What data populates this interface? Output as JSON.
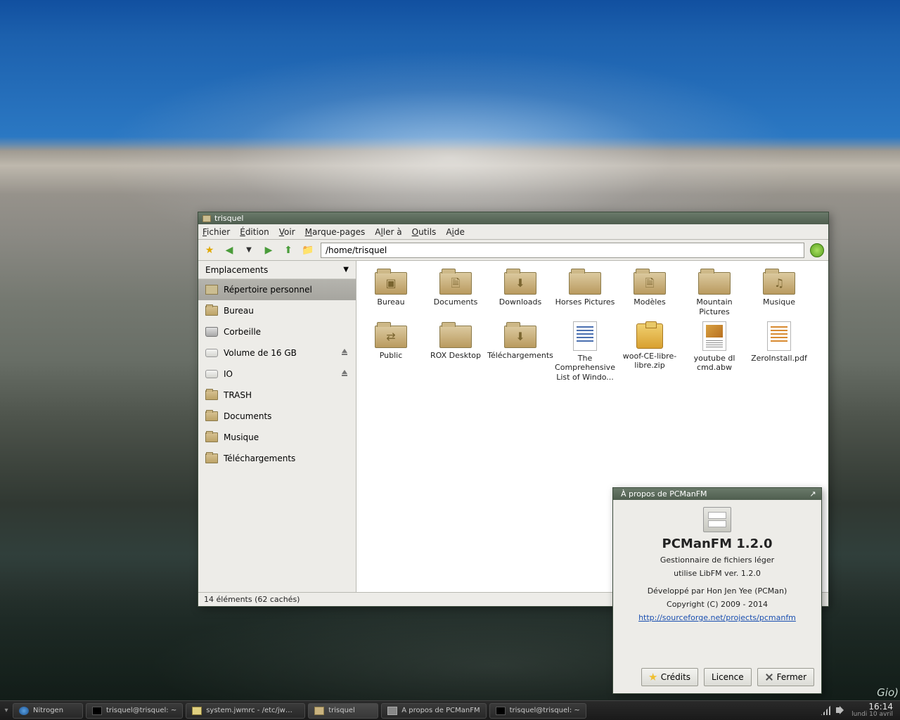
{
  "desktop": {
    "corner_text": "Gio)"
  },
  "fm": {
    "title": "trisquel",
    "menu": [
      "Fichier",
      "Édition",
      "Voir",
      "Marque-pages",
      "Aller à",
      "Outils",
      "Aide"
    ],
    "menu_underline": [
      "F",
      "É",
      "V",
      "M",
      "l",
      "O",
      "i"
    ],
    "path": "/home/trisquel",
    "side_header": "Emplacements",
    "places": [
      {
        "label": "Répertoire personnel",
        "icon": "home",
        "sel": true
      },
      {
        "label": "Bureau",
        "icon": "folder"
      },
      {
        "label": "Corbeille",
        "icon": "trash"
      },
      {
        "label": "Volume de 16 GB",
        "icon": "drive",
        "eject": true
      },
      {
        "label": "IO",
        "icon": "drive",
        "eject": true
      },
      {
        "label": "TRASH",
        "icon": "folder"
      },
      {
        "label": "Documents",
        "icon": "folder"
      },
      {
        "label": "Musique",
        "icon": "folder"
      },
      {
        "label": "Téléchargements",
        "icon": "folder"
      }
    ],
    "files": [
      {
        "name": "Bureau",
        "t": "folder",
        "em": "▣"
      },
      {
        "name": "Documents",
        "t": "folder",
        "em": "🗎"
      },
      {
        "name": "Downloads",
        "t": "folder",
        "em": "⬇"
      },
      {
        "name": "Horses Pictures",
        "t": "folder"
      },
      {
        "name": "Modèles",
        "t": "folder",
        "em": "🗎"
      },
      {
        "name": "Mountain Pictures",
        "t": "folder"
      },
      {
        "name": "Musique",
        "t": "folder",
        "em": "♫"
      },
      {
        "name": "Public",
        "t": "folder",
        "em": "⇄"
      },
      {
        "name": "ROX Desktop",
        "t": "folder"
      },
      {
        "name": "Téléchargements",
        "t": "folder",
        "em": "⬇"
      },
      {
        "name": "The Comprehensive List of Windo...",
        "t": "doc"
      },
      {
        "name": "woof-CE-libre-libre.zip",
        "t": "zip"
      },
      {
        "name": "youtube dl cmd.abw",
        "t": "abw"
      },
      {
        "name": "ZeroInstall.pdf",
        "t": "doc",
        "orange": true
      }
    ],
    "status": "14 éléments (62 cachés)"
  },
  "about": {
    "title": "À propos de PCManFM",
    "name": "PCManFM 1.2.0",
    "desc1": "Gestionnaire de fichiers léger",
    "desc2": "utilise LibFM ver. 1.2.0",
    "dev": "Développé par Hon Jen Yee (PCMan)",
    "copy": "Copyright (C) 2009 - 2014",
    "link": "http://sourceforge.net/projects/pcmanfm",
    "btn_credits": "Crédits",
    "btn_licence": "Licence",
    "btn_close": "Fermer"
  },
  "taskbar": {
    "items": [
      {
        "label": "Nitrogen",
        "icon": "app"
      },
      {
        "label": "trisquel@trisquel: ~",
        "icon": "term"
      },
      {
        "label": "system.jwmrc - /etc/jwm - ...",
        "icon": "edit"
      },
      {
        "label": "trisquel",
        "icon": "fold",
        "active": true
      },
      {
        "label": "À propos de PCManFM",
        "icon": "win"
      },
      {
        "label": "trisquel@trisquel: ~",
        "icon": "term"
      }
    ],
    "time": "16:14",
    "date": "lundi 10 avril"
  }
}
